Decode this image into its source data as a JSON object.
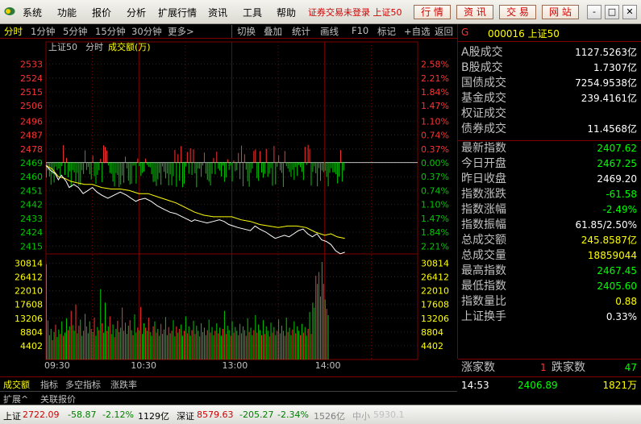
{
  "menu": {
    "items": [
      "系统",
      "功能",
      "报价",
      "分析",
      "扩展行情",
      "资讯",
      "工具",
      "帮助"
    ],
    "status": "证券交易未登录 上证50",
    "buttons": [
      "行 情",
      "资 讯",
      "交 易",
      "网 站"
    ],
    "window_buttons": [
      "-",
      "□",
      "✕"
    ]
  },
  "toolbar": {
    "periods": [
      "分时",
      "1分钟",
      "5分钟",
      "15分钟",
      "30分钟",
      "更多>"
    ],
    "tools": [
      "切换",
      "叠加",
      "统计",
      "画线",
      "F10",
      "标记",
      "+自选",
      "返回"
    ]
  },
  "chart_data": {
    "type": "line",
    "title": "上证50",
    "legend": [
      "分时",
      "成交额(万)"
    ],
    "price_axis": {
      "ticks": [
        2533,
        2524,
        2515,
        2506,
        2496,
        2487,
        2478,
        2469,
        2460,
        2451,
        2442,
        2433,
        2424,
        2415
      ],
      "ylim": [
        2412,
        2538
      ],
      "prev_close": 2469.2
    },
    "pct_axis": {
      "ticks": [
        "2.58%",
        "2.21%",
        "1.84%",
        "1.47%",
        "1.10%",
        "0.74%",
        "0.37%",
        "0.00%",
        "0.37%",
        "0.74%",
        "1.10%",
        "1.47%",
        "1.84%",
        "2.21%"
      ]
    },
    "volume_axis": {
      "ticks": [
        30814,
        26412,
        22010,
        17608,
        13206,
        8804,
        4402
      ],
      "ylim": [
        0,
        33000
      ]
    },
    "x_ticks": [
      "09:30",
      "10:30",
      "13:00",
      "14:00"
    ],
    "minutes_total": 240,
    "minutes_elapsed": 193,
    "price_series": [
      [
        0,
        2467.25
      ],
      [
        3,
        2464
      ],
      [
        6,
        2462
      ],
      [
        8,
        2458
      ],
      [
        10,
        2461
      ],
      [
        13,
        2457
      ],
      [
        15,
        2453
      ],
      [
        18,
        2455
      ],
      [
        21,
        2453
      ],
      [
        24,
        2449
      ],
      [
        27,
        2451
      ],
      [
        30,
        2453
      ],
      [
        33,
        2450
      ],
      [
        36,
        2448
      ],
      [
        40,
        2446
      ],
      [
        44,
        2448
      ],
      [
        48,
        2450
      ],
      [
        52,
        2448
      ],
      [
        55,
        2446
      ],
      [
        58,
        2444
      ],
      [
        60,
        2445
      ],
      [
        64,
        2446
      ],
      [
        68,
        2444
      ],
      [
        72,
        2441
      ],
      [
        76,
        2439
      ],
      [
        80,
        2437
      ],
      [
        84,
        2436
      ],
      [
        88,
        2434
      ],
      [
        90,
        2433
      ],
      [
        92,
        2432
      ],
      [
        94,
        2431
      ],
      [
        96,
        2432
      ],
      [
        100,
        2431
      ],
      [
        104,
        2430
      ],
      [
        108,
        2431
      ],
      [
        112,
        2432
      ],
      [
        115,
        2431
      ],
      [
        118,
        2429
      ],
      [
        121,
        2428
      ],
      [
        124,
        2427
      ],
      [
        128,
        2426
      ],
      [
        132,
        2425
      ],
      [
        135,
        2428
      ],
      [
        138,
        2426
      ],
      [
        142,
        2424
      ],
      [
        145,
        2422
      ],
      [
        148,
        2420
      ],
      [
        151,
        2421
      ],
      [
        154,
        2422
      ],
      [
        157,
        2421
      ],
      [
        160,
        2423
      ],
      [
        163,
        2425
      ],
      [
        166,
        2426
      ],
      [
        169,
        2423
      ],
      [
        172,
        2421
      ],
      [
        175,
        2423
      ],
      [
        178,
        2419
      ],
      [
        181,
        2418
      ],
      [
        184,
        2416
      ],
      [
        187,
        2412
      ],
      [
        190,
        2410
      ],
      [
        193,
        2411
      ]
    ],
    "avg_series": [
      [
        0,
        2467.25
      ],
      [
        4,
        2465
      ],
      [
        8,
        2460
      ],
      [
        12,
        2459
      ],
      [
        16,
        2457
      ],
      [
        20,
        2456
      ],
      [
        25,
        2455
      ],
      [
        30,
        2455
      ],
      [
        36,
        2453
      ],
      [
        42,
        2452
      ],
      [
        48,
        2452
      ],
      [
        54,
        2451
      ],
      [
        60,
        2449
      ],
      [
        66,
        2449
      ],
      [
        72,
        2447
      ],
      [
        78,
        2445
      ],
      [
        84,
        2443
      ],
      [
        90,
        2440
      ],
      [
        96,
        2437
      ],
      [
        102,
        2435
      ],
      [
        108,
        2434
      ],
      [
        114,
        2434
      ],
      [
        120,
        2434
      ],
      [
        126,
        2432
      ],
      [
        132,
        2431
      ],
      [
        138,
        2429
      ],
      [
        144,
        2428
      ],
      [
        150,
        2427
      ],
      [
        156,
        2428
      ],
      [
        162,
        2428
      ],
      [
        168,
        2427
      ],
      [
        174,
        2424
      ],
      [
        180,
        2422
      ],
      [
        184,
        2423
      ],
      [
        188,
        2421
      ],
      [
        193,
        2420
      ]
    ],
    "volume_series": [
      30500,
      12500,
      7800,
      9800,
      6200,
      8800,
      11200,
      7200,
      9600,
      8200,
      12200,
      7600,
      8600,
      13200,
      9400,
      10600,
      15600,
      11000,
      9200,
      17600,
      8400,
      10800,
      12800,
      7600,
      9200,
      14600,
      10600,
      8400,
      12200,
      9800,
      8800,
      13400,
      7600,
      10400,
      9400,
      22500,
      11600,
      8600,
      18200,
      9200,
      10600,
      13800,
      8200,
      11200,
      7200,
      9800,
      12400,
      8800,
      10200,
      16600,
      9200,
      11800,
      8200,
      10800,
      12600,
      9400,
      7800,
      14400,
      8600,
      10200,
      9400,
      16800,
      8200,
      11600,
      10200,
      9200,
      13400,
      8800,
      7600,
      10600,
      12200,
      8600,
      9800,
      7600,
      11400,
      8200,
      9600,
      13600,
      7800,
      10400,
      8400,
      9200,
      12600,
      7400,
      10600,
      8600,
      9800,
      11200,
      7600,
      9200,
      13800,
      8400,
      10600,
      7600,
      9400,
      12400,
      8200,
      10800,
      9200,
      7400,
      11600,
      8800,
      10200,
      7800,
      9400,
      12800,
      8600,
      10400,
      7800,
      9200,
      11600,
      8400,
      10200,
      7600,
      9800,
      15600,
      8200,
      10800,
      9400,
      7600,
      12200,
      8600,
      10400,
      9200,
      7800,
      11400,
      8400,
      10600,
      9400,
      7600,
      13200,
      8800,
      10200,
      7800,
      9400,
      14200,
      8600,
      11200,
      9400,
      7800,
      12600,
      8200,
      10600,
      9200,
      7400,
      11800,
      8600,
      10400,
      7800,
      9200,
      12800,
      8400,
      10800,
      9200,
      7600,
      13400,
      8800,
      10200,
      7800,
      9600,
      12200,
      8400,
      10600,
      9200,
      7800,
      11400,
      8600,
      10400,
      7600,
      9800,
      15200,
      8200,
      18200,
      16600,
      26800,
      24200,
      28000,
      20200,
      31200,
      24200,
      19200,
      16200,
      14200
    ],
    "bar_series_seed": 7,
    "colors": {
      "up": "#ff3232",
      "down": "#00c800",
      "price": "#ffffff",
      "avg": "#ffff00",
      "grid": "#800000",
      "axis_red": "#ff3232",
      "axis_green": "#00c800"
    }
  },
  "panel": {
    "header_flag": "G",
    "header_code": "000016 上证50",
    "rows": [
      {
        "label": "A股成交",
        "value": "1127.5263亿",
        "color": "#ffffff"
      },
      {
        "label": "B股成交",
        "value": "1.7307亿",
        "color": "#ffffff"
      },
      {
        "label": "国债成交",
        "value": "7254.9538亿",
        "color": "#ffffff"
      },
      {
        "label": "基金成交",
        "value": "239.4161亿",
        "color": "#ffffff"
      },
      {
        "label": "权证成交",
        "value": "",
        "color": "#ffffff"
      },
      {
        "label": "债券成交",
        "value": "11.4568亿",
        "color": "#ffffff"
      }
    ],
    "rows2": [
      {
        "label": "最新指数",
        "value": "2407.62",
        "color": "#00ff00"
      },
      {
        "label": "今日开盘",
        "value": "2467.25",
        "color": "#00ff00"
      },
      {
        "label": "昨日收盘",
        "value": "2469.20",
        "color": "#ffffff"
      },
      {
        "label": "指数涨跌",
        "value": "-61.58",
        "color": "#00ff00"
      },
      {
        "label": "指数涨幅",
        "value": "-2.49%",
        "color": "#00ff00"
      },
      {
        "label": "指数振幅",
        "value": "61.85/2.50%",
        "color": "#ffffff"
      },
      {
        "label": "总成交额",
        "value": "245.8587亿",
        "color": "#ffff00"
      },
      {
        "label": "总成交量",
        "value": "18859044",
        "color": "#ffff00"
      },
      {
        "label": "最高指数",
        "value": "2467.45",
        "color": "#00ff00"
      },
      {
        "label": "最低指数",
        "value": "2405.60",
        "color": "#00ff00"
      },
      {
        "label": "指数量比",
        "value": "0.88",
        "color": "#ffff00"
      },
      {
        "label": "上证换手",
        "value": "0.33%",
        "color": "#ffffff"
      }
    ],
    "advance": {
      "up_label": "涨家数",
      "up_value": "1",
      "down_label": "跌家数",
      "down_value": "47"
    },
    "time_row": {
      "time": "14:53",
      "price": "2406.89",
      "volume": "1821万"
    }
  },
  "tabs": [
    "成交额",
    "指标",
    "多空指标",
    "涨跌率"
  ],
  "tabs2": [
    "扩展^",
    "关联报价"
  ],
  "statusbar": {
    "sh_label": "上证",
    "sh_index": "2722.09",
    "sh_change": "-58.87",
    "sh_pct": "-2.12%",
    "sh_amount": "1129亿",
    "sz_label": "深证",
    "sz_index": "8579.63",
    "sz_change": "-205.27",
    "sz_pct": "-2.34%",
    "sz_amount": "1526亿",
    "sme_label": "中小",
    "sme_index": "5930.1"
  }
}
